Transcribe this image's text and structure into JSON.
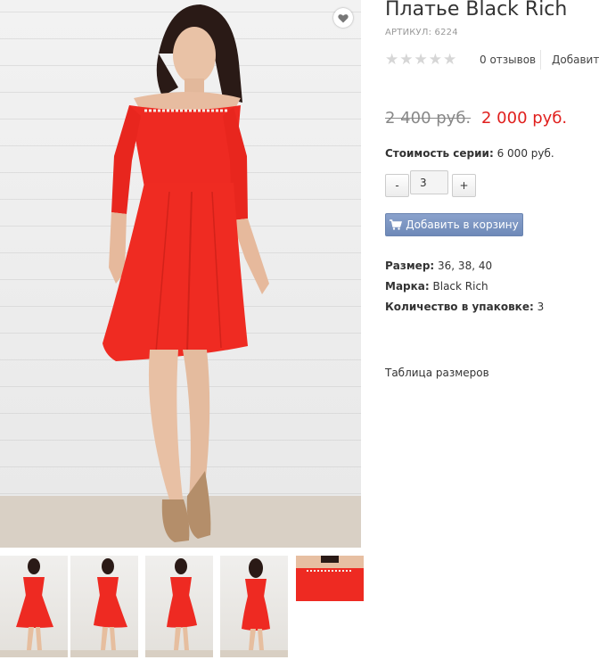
{
  "product": {
    "title": "Платье Black Rich",
    "sku": "АРТИКУЛ: 6224",
    "reviews_count": "0 отзывов",
    "add_review": "Добавить",
    "rating": 0,
    "old_price": "2 400 руб.",
    "new_price": "2 000 руб.",
    "series_label": "Стоимость серии:",
    "series_value": "6 000 руб.",
    "qty_minus": "-",
    "qty_value": "3",
    "qty_plus": "+",
    "add_to_cart": "Добавить в корзину",
    "attributes": [
      {
        "label": "Размер:",
        "value": "36, 38, 40"
      },
      {
        "label": "Марка:",
        "value": "Black Rich"
      },
      {
        "label": "Количество в упаковке:",
        "value": "3"
      }
    ],
    "size_table": "Таблица размеров"
  },
  "colors": {
    "price_red": "#e0201e",
    "dress_red": "#ee2a22",
    "button_blue": "#7a94c2"
  },
  "icons": {
    "favorite": "heart-icon",
    "cart": "cart-icon",
    "star": "star-icon"
  }
}
